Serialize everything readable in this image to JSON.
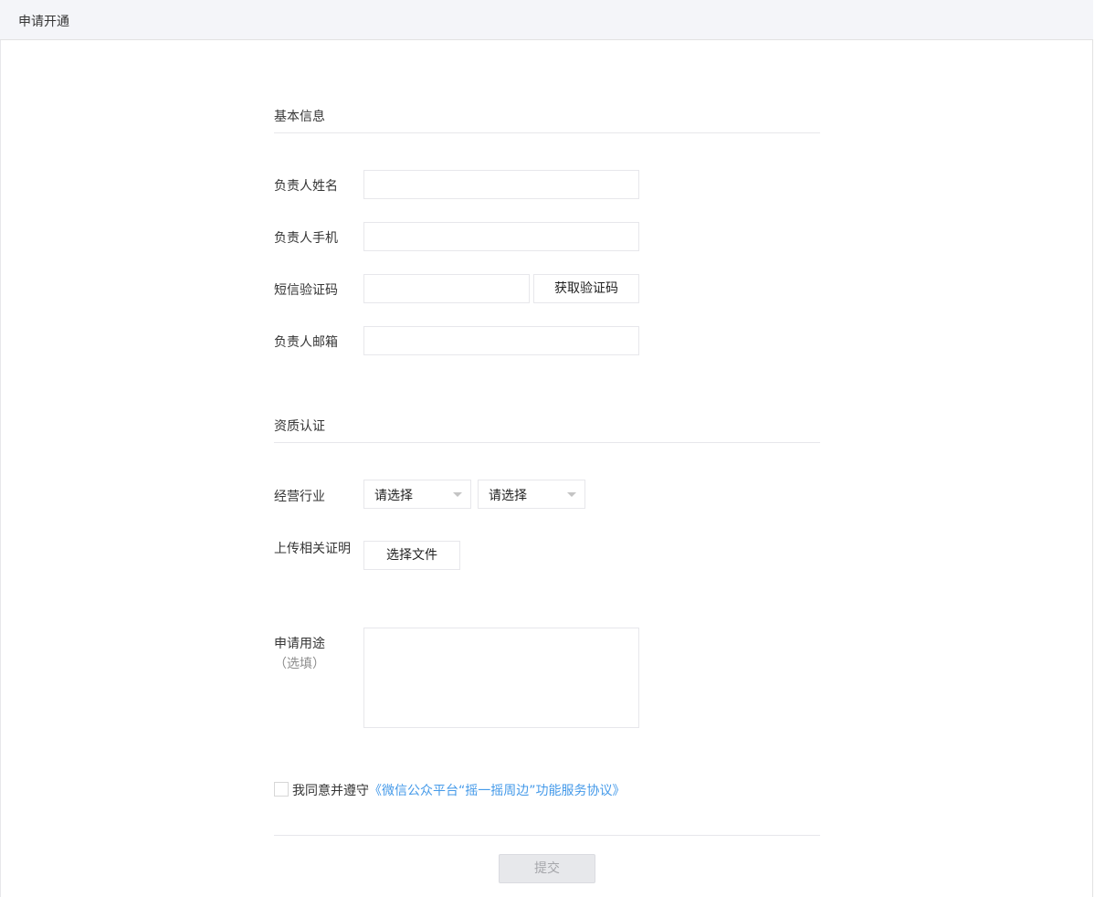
{
  "header": {
    "title": "申请开通"
  },
  "basic_info": {
    "section_title": "基本信息",
    "fields": {
      "name": {
        "label": "负责人姓名",
        "value": "",
        "placeholder": ""
      },
      "phone": {
        "label": "负责人手机",
        "value": "",
        "placeholder": ""
      },
      "sms": {
        "label": "短信验证码",
        "value": "",
        "placeholder": "",
        "button_label": "获取验证码"
      },
      "email": {
        "label": "负责人邮箱",
        "value": "",
        "placeholder": ""
      }
    }
  },
  "qualification": {
    "section_title": "资质认证",
    "industry": {
      "label": "经营行业",
      "select1": "请选择",
      "select2": "请选择"
    },
    "upload": {
      "label": "上传相关证明",
      "button_label": "选择文件"
    },
    "purpose": {
      "label": "申请用途",
      "sub_label": "（选填）",
      "value": ""
    }
  },
  "agreement": {
    "checked": false,
    "text": "我同意并遵守",
    "link_text": "《微信公众平台“摇一摇周边”功能服务协议》"
  },
  "submit": {
    "label": "提交",
    "disabled": true
  },
  "colors": {
    "link": "#459ae9",
    "header_bg": "#f4f5f9",
    "border": "#e7e7eb",
    "disabled_bg": "#e7e8eb"
  }
}
